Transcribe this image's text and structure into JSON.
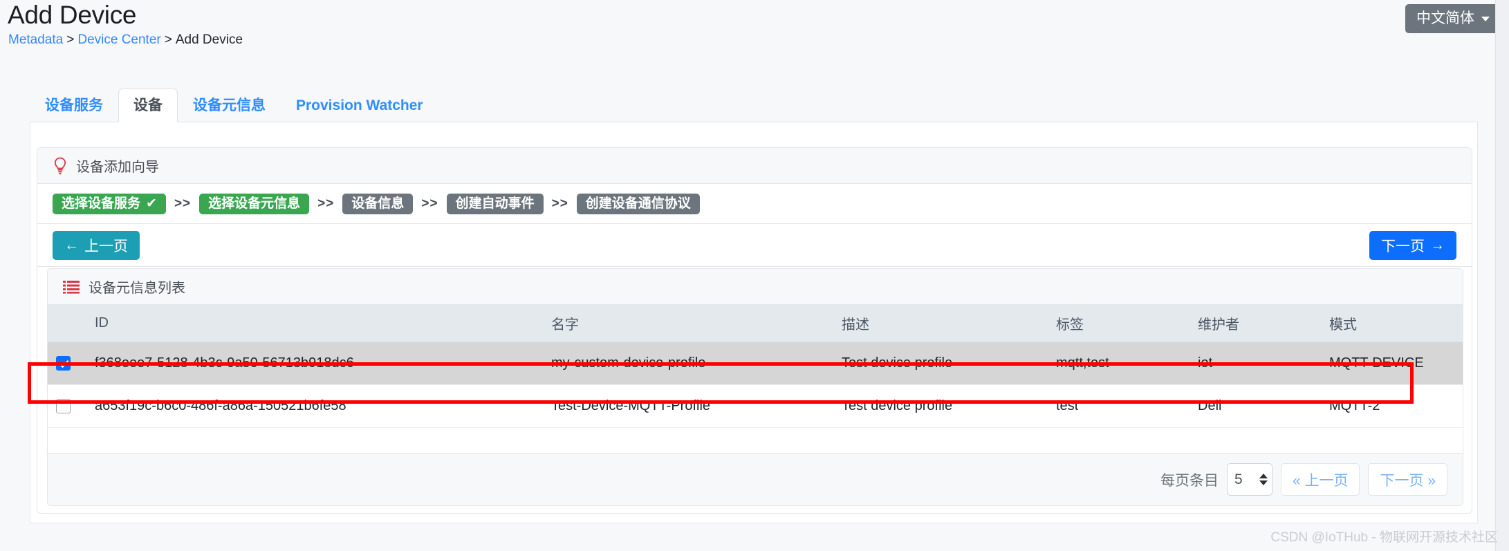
{
  "header": {
    "title": "Add Device",
    "breadcrumb": [
      {
        "label": "Metadata",
        "link": true
      },
      {
        "label": ">",
        "link": false
      },
      {
        "label": "Device Center",
        "link": true
      },
      {
        "label": ">",
        "link": false
      },
      {
        "label": "Add Device",
        "link": false
      }
    ],
    "lang_button": "中文简体",
    "caret_icon": "chevron-down-icon"
  },
  "tabs": [
    {
      "label": "设备服务",
      "active": false
    },
    {
      "label": "设备",
      "active": true
    },
    {
      "label": "设备元信息",
      "active": false
    },
    {
      "label": "Provision Watcher",
      "active": false
    }
  ],
  "wizard": {
    "icon": "lightbulb-icon",
    "title": "设备添加向导",
    "steps": [
      {
        "label": "选择设备服务",
        "state": "done",
        "check": "✔"
      },
      {
        "label": "选择设备元信息",
        "state": "active",
        "check": ""
      },
      {
        "label": "设备信息",
        "state": "pending",
        "check": ""
      },
      {
        "label": "创建自动事件",
        "state": "pending",
        "check": ""
      },
      {
        "label": "创建设备通信协议",
        "state": "pending",
        "check": ""
      }
    ],
    "separator": ">>",
    "prev_button": "上一页",
    "prev_arrow": "←",
    "next_button": "下一页",
    "next_arrow": "→"
  },
  "list": {
    "icon": "list-icon",
    "title": "设备元信息列表",
    "columns": [
      "",
      "ID",
      "名字",
      "描述",
      "标签",
      "维护者",
      "模式"
    ],
    "rows": [
      {
        "checked": true,
        "id": "f368eee7-5128-4b3c-9a50-56713b918dc6",
        "name": "my-custom-device-profile",
        "description": "Test device profile",
        "labels": "mqtt,test",
        "manufacturer": "iot",
        "model": "MQTT-DEVICE"
      },
      {
        "checked": false,
        "id": "a653f19c-b6c0-486f-a86a-150521b6fe58",
        "name": "Test-Device-MQTT-Profile",
        "description": "Test device profile",
        "labels": "test",
        "manufacturer": "Dell",
        "model": "MQTT-2"
      }
    ]
  },
  "pagination": {
    "per_page_label": "每页条目",
    "per_page_value": "5",
    "prev_label": "« 上一页",
    "next_label": "下一页 »"
  },
  "watermark": "CSDN @IoTHub - 物联网开源技术社区",
  "colors": {
    "link": "#3388ff",
    "tab_active_text": "#495057",
    "step_done": "#3aa650",
    "step_pending": "#6c757d",
    "prev_button": "#1c9fb4",
    "next_button": "#0d6efd",
    "annotation": "#ff0000",
    "accent_icon_red": "#dc3545"
  }
}
